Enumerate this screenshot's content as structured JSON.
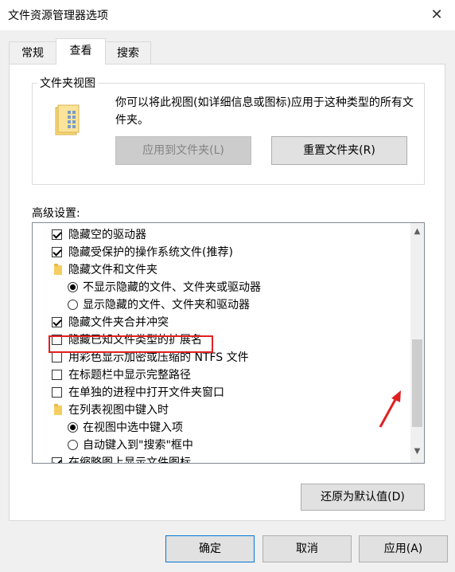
{
  "window": {
    "title": "文件资源管理器选项"
  },
  "tabs": [
    {
      "label": "常规"
    },
    {
      "label": "查看"
    },
    {
      "label": "搜索"
    }
  ],
  "folder_views": {
    "title": "文件夹视图",
    "description": "你可以将此视图(如详细信息或图标)应用于这种类型的所有文件夹。",
    "apply_button": "应用到文件夹(L)",
    "reset_button": "重置文件夹(R)"
  },
  "advanced": {
    "label": "高级设置:",
    "items": [
      {
        "type": "checkbox",
        "checked": true,
        "label": "隐藏空的驱动器"
      },
      {
        "type": "checkbox",
        "checked": true,
        "label": "隐藏受保护的操作系统文件(推荐)"
      },
      {
        "type": "folder",
        "label": "隐藏文件和文件夹"
      },
      {
        "type": "radio",
        "checked": true,
        "label": "不显示隐藏的文件、文件夹或驱动器"
      },
      {
        "type": "radio",
        "checked": false,
        "label": "显示隐藏的文件、文件夹和驱动器"
      },
      {
        "type": "checkbox",
        "checked": true,
        "label": "隐藏文件夹合并冲突"
      },
      {
        "type": "checkbox",
        "checked": false,
        "label": "隐藏已知文件类型的扩展名"
      },
      {
        "type": "checkbox",
        "checked": false,
        "label": "用彩色显示加密或压缩的 NTFS 文件"
      },
      {
        "type": "checkbox",
        "checked": false,
        "label": "在标题栏中显示完整路径"
      },
      {
        "type": "checkbox",
        "checked": false,
        "label": "在单独的进程中打开文件夹窗口"
      },
      {
        "type": "folder",
        "label": "在列表视图中键入时"
      },
      {
        "type": "radio",
        "checked": true,
        "label": "在视图中选中键入项"
      },
      {
        "type": "radio",
        "checked": false,
        "label": "自动键入到\"搜索\"框中"
      },
      {
        "type": "checkbox",
        "checked": true,
        "label": "在缩略图上显示文件图标"
      }
    ],
    "restore_button": "还原为默认值(D)"
  },
  "footer": {
    "ok": "确定",
    "cancel": "取消",
    "apply": "应用(A)"
  },
  "colors": {
    "highlight_box": "#e02020",
    "annotation_arrow": "#e02020"
  },
  "icons": {
    "close": "close-icon",
    "folder": "folder-icon",
    "scroll_up": "chevron-up-icon",
    "scroll_down": "chevron-down-icon"
  }
}
